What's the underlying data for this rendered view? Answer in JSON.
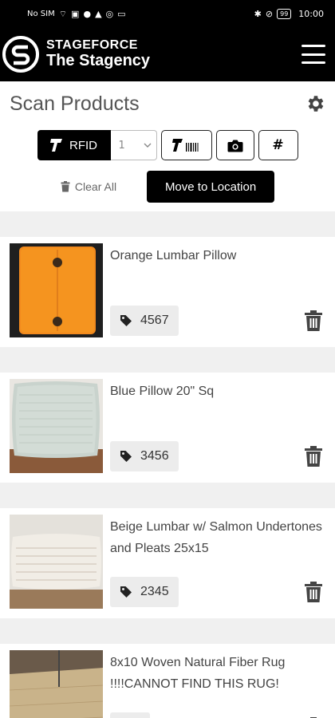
{
  "status_bar": {
    "carrier": "No SIM",
    "battery": "99",
    "time": "10:00"
  },
  "app_bar": {
    "brand_line1": "STAGEFORCE",
    "brand_line2": "The Stagency"
  },
  "page": {
    "title": "Scan Products"
  },
  "toolbar": {
    "rfid_label": "RFID",
    "quantity_value": "1",
    "manual_entry_label": "#"
  },
  "actions": {
    "clear_all_label": "Clear All",
    "move_label": "Move to Location"
  },
  "products": [
    {
      "name": "Orange Lumbar Pillow",
      "tag": "4567",
      "image": "orange-lumbar-pillow"
    },
    {
      "name": "Blue Pillow 20\" Sq",
      "tag": "3456",
      "image": "blue-square-pillow"
    },
    {
      "name": "Beige Lumbar w/ Salmon Undertones and Pleats 25x15",
      "tag": "2345",
      "image": "beige-pleated-lumbar-pillow"
    },
    {
      "name": "8x10 Woven Natural Fiber Rug !!!!CANNOT FIND THIS RUG!",
      "tag": "",
      "image": "natural-fiber-rug"
    }
  ],
  "colors": {
    "header_bg": "#000000",
    "panel_bg": "#ffffff",
    "page_bg": "#f0f0f0",
    "primary_button": "#000000"
  }
}
